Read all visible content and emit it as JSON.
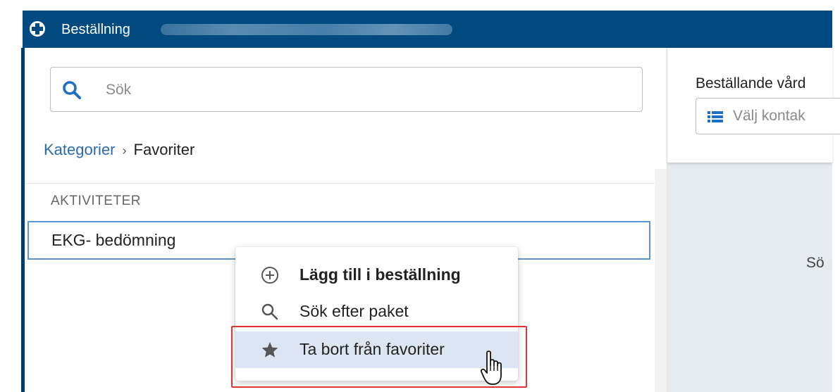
{
  "window": {
    "title": "Beställning",
    "logo_icon": "plus-circle-icon",
    "title_color": "#004a80"
  },
  "search": {
    "placeholder": "Sök",
    "value": "",
    "icon": "search-icon",
    "icon_color": "#1e6fc2"
  },
  "breadcrumb": {
    "root": "Kategorier",
    "separator": "›",
    "current": "Favoriter"
  },
  "list": {
    "section_title": "AKTIVITETER",
    "items": [
      {
        "label": "EKG- bedömning",
        "selected": true
      }
    ]
  },
  "context_menu": {
    "items": [
      {
        "label": "Lägg till i beställning",
        "icon": "plus-circle-outline-icon",
        "bold": true
      },
      {
        "label": "Sök efter paket",
        "icon": "search-icon",
        "bold": false
      },
      {
        "label": "Ta bort från favoriter",
        "icon": "star-icon",
        "bold": false,
        "hovered": true
      }
    ]
  },
  "right_panel": {
    "label": "Beställande vård",
    "contact_placeholder": "Välj kontak",
    "contact_icon": "list-icon",
    "body_text": "Sö"
  },
  "colors": {
    "accent": "#2b6cb0",
    "highlight": "#e0363a",
    "hover_bg": "#dce6f2",
    "selection_border": "#5b95d3"
  }
}
